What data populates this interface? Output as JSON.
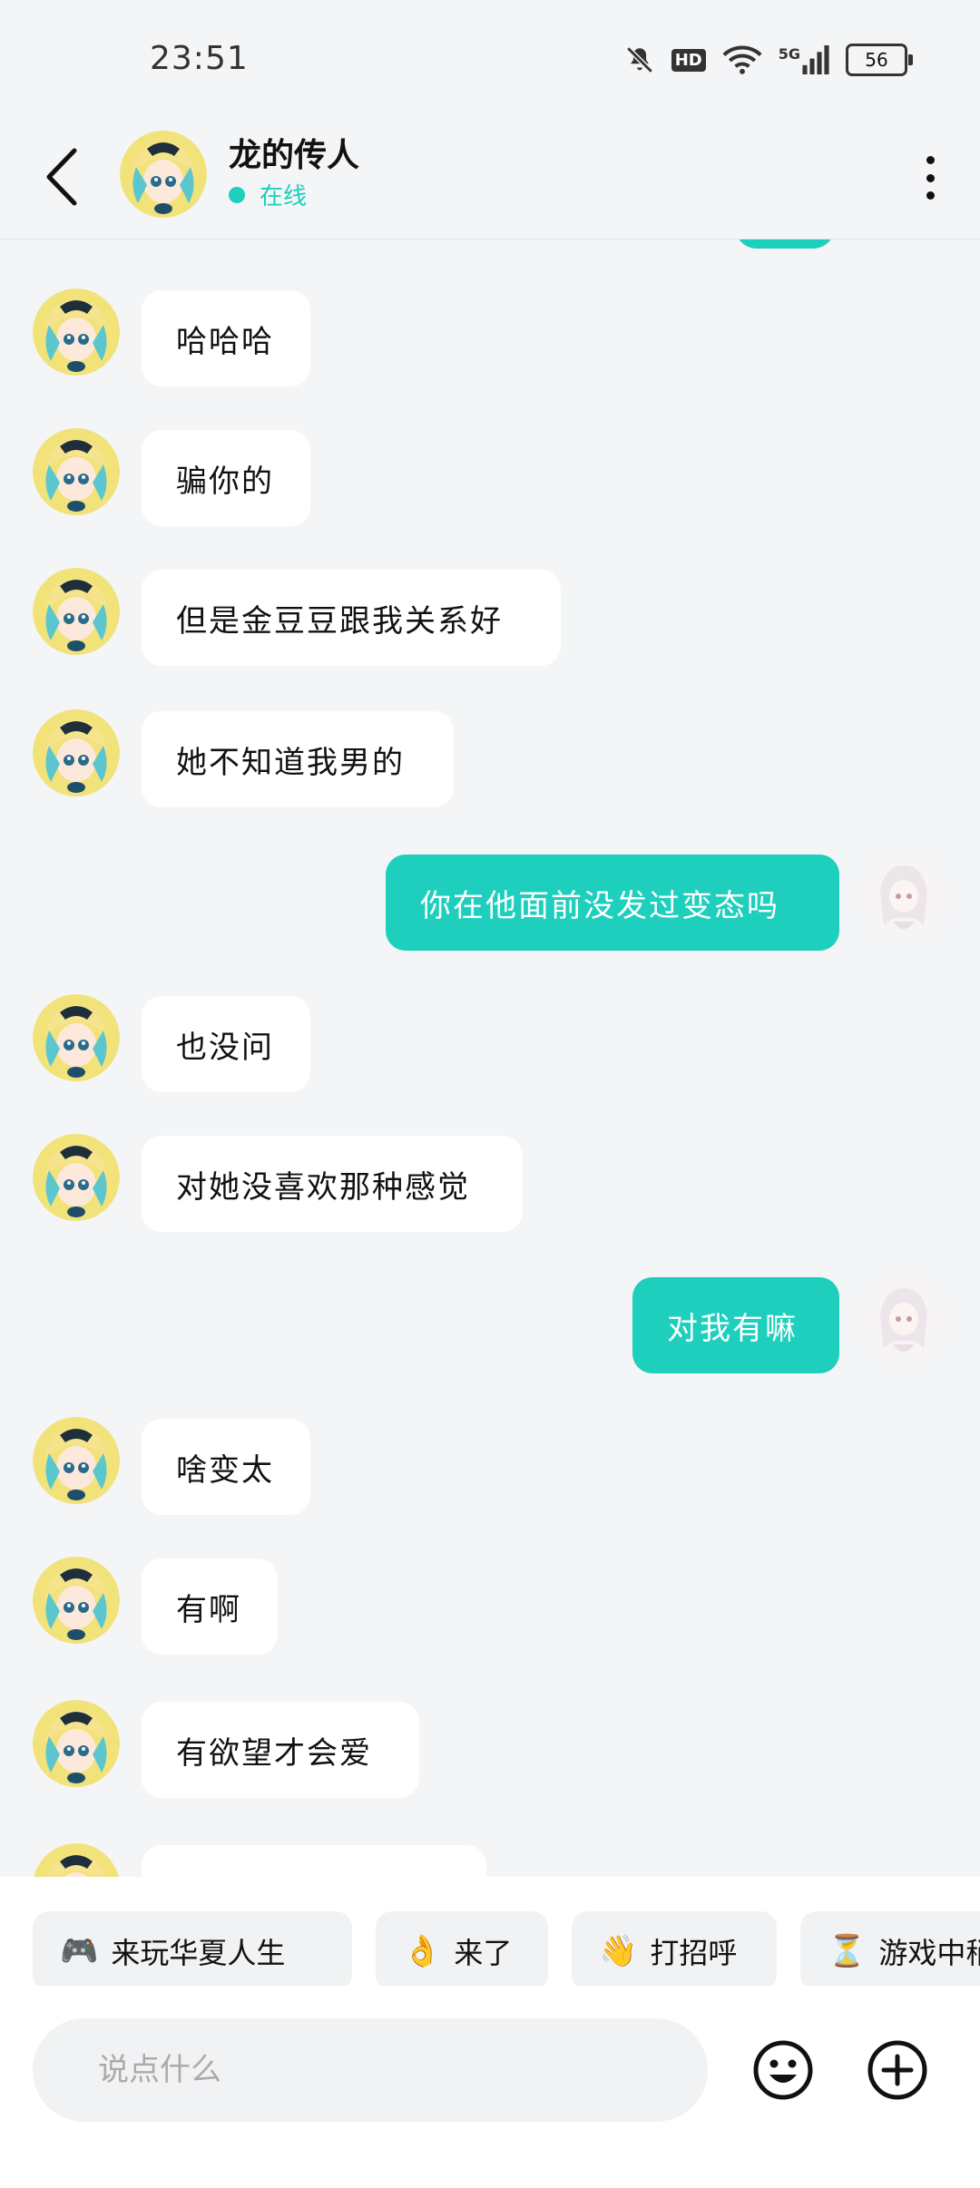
{
  "status_bar": {
    "time": "23:51",
    "hd": "HD",
    "network": "5G",
    "battery": "56"
  },
  "header": {
    "name": "龙的传人",
    "status": "在线"
  },
  "messages": [
    {
      "dir": "in",
      "text": "哈哈哈"
    },
    {
      "dir": "in",
      "text": "骗你的"
    },
    {
      "dir": "in",
      "text": "但是金豆豆跟我关系好"
    },
    {
      "dir": "in",
      "text": "她不知道我男的"
    },
    {
      "dir": "out",
      "text": "你在他面前没发过变态吗"
    },
    {
      "dir": "in",
      "text": "也没问"
    },
    {
      "dir": "in",
      "text": "对她没喜欢那种感觉"
    },
    {
      "dir": "out",
      "text": "对我有嘛"
    },
    {
      "dir": "in",
      "text": "啥变太"
    },
    {
      "dir": "in",
      "text": "有啊"
    },
    {
      "dir": "in",
      "text": "有欲望才会爱"
    },
    {
      "dir": "in",
      "text": ""
    }
  ],
  "quick_replies": [
    {
      "emoji": "🎮",
      "label": "来玩华夏人生"
    },
    {
      "emoji": "👌",
      "label": "来了"
    },
    {
      "emoji": "👋",
      "label": "打招呼"
    },
    {
      "emoji": "⏳",
      "label": "游戏中稍"
    }
  ],
  "input": {
    "placeholder": "说点什么"
  },
  "colors": {
    "accent": "#1dcfbc",
    "background": "#f4f5f7",
    "incoming_bubble": "#ffffff"
  },
  "icons": [
    "back-arrow-icon",
    "more-vertical-icon",
    "emoji-icon",
    "add-circle-icon",
    "mute-icon",
    "wifi-icon",
    "signal-icon",
    "battery-icon"
  ]
}
